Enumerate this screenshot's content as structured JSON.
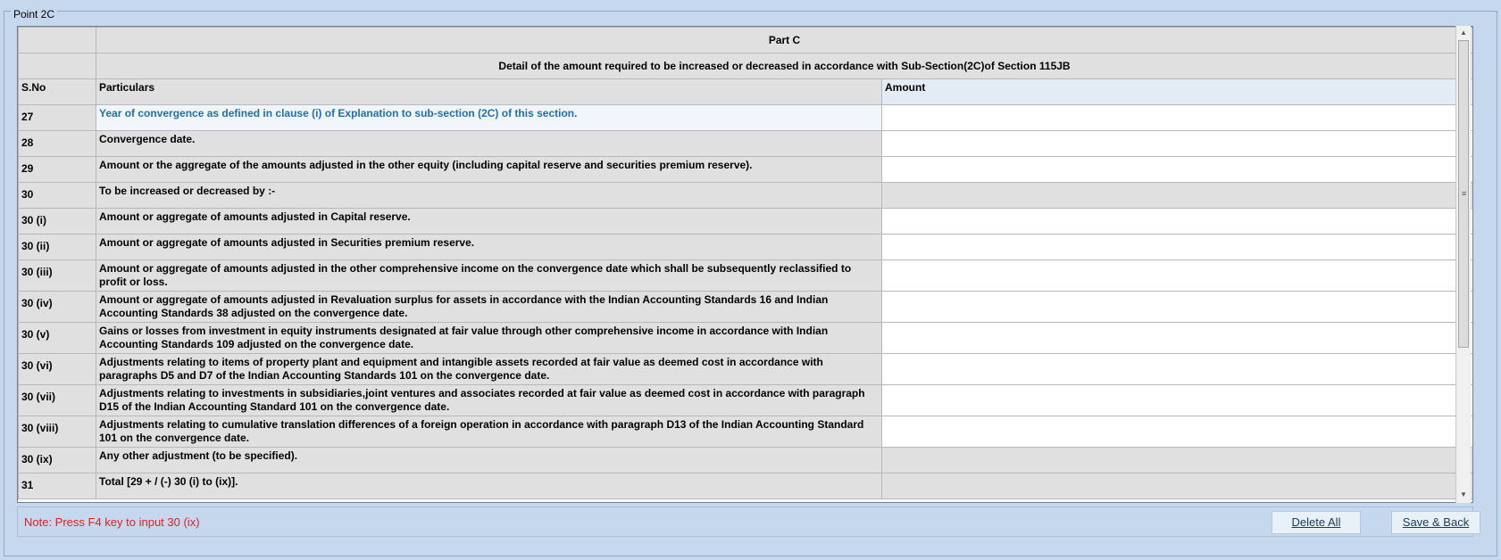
{
  "window": {
    "title": "Point 2C"
  },
  "table": {
    "header_part": "Part C",
    "header_detail": "Detail of the amount required to be increased or decreased in accordance with Sub-Section(2C)of Section 115JB",
    "columns": {
      "sno": "S.No",
      "particulars": "Particulars",
      "amount": "Amount"
    },
    "rows": [
      {
        "sno": "27",
        "particulars": "Year of convergence as defined in clause (i) of Explanation to sub-section (2C) of this section.",
        "amount": ""
      },
      {
        "sno": "28",
        "particulars": "Convergence date.",
        "amount": ""
      },
      {
        "sno": "29",
        "particulars": "Amount or the aggregate of the amounts adjusted in the other equity (including capital reserve and securities premium reserve).",
        "amount": ""
      },
      {
        "sno": "30",
        "particulars": "To be increased or decreased by :-",
        "amount": ""
      },
      {
        "sno": "30 (i)",
        "particulars": "Amount or  aggregate of amounts adjusted in  Capital reserve.",
        "amount": ""
      },
      {
        "sno": "30 (ii)",
        "particulars": "Amount or aggregate of amounts adjusted in Securities premium reserve.",
        "amount": ""
      },
      {
        "sno": "30 (iii)",
        "particulars": "Amount or aggregate of amounts adjusted in the other comprehensive income on the convergence date which shall be subsequently reclassified to profit or loss.",
        "amount": ""
      },
      {
        "sno": "30 (iv)",
        "particulars": "Amount or aggregate of amounts adjusted in Revaluation surplus for assets in accordance with the Indian Accounting Standards 16 and Indian Accounting Standards 38 adjusted on the convergence date.",
        "amount": ""
      },
      {
        "sno": "30 (v)",
        "particulars": "Gains or losses from investment in equity instruments designated at fair value through other comprehensive income in accordance with Indian Accounting Standards 109 adjusted on the convergence date.",
        "amount": ""
      },
      {
        "sno": "30 (vi)",
        "particulars": "Adjustments relating to items of property plant and equipment and intangible assets recorded at fair value as deemed cost in accordance with paragraphs D5 and D7 of the Indian Accounting Standards 101 on the convergence date.",
        "amount": ""
      },
      {
        "sno": "30 (vii)",
        "particulars": "Adjustments relating to investments in subsidiaries,joint ventures and associates recorded at fair value as deemed cost in accordance with paragraph D15 of the Indian Accounting Standard 101 on the convergence date.",
        "amount": ""
      },
      {
        "sno": "30 (viii)",
        "particulars": "Adjustments relating to cumulative translation differences of a foreign operation in accordance with paragraph D13 of the Indian Accounting Standard 101 on the convergence date.",
        "amount": ""
      },
      {
        "sno": "30 (ix)",
        "particulars": "Any other adjustment (to be specified).",
        "amount": ""
      },
      {
        "sno": "31",
        "particulars": "Total [29 + / (-) 30 (i) to (ix)].",
        "amount": ""
      }
    ]
  },
  "footer": {
    "note": "Note: Press F4 key to input 30 (ix)",
    "delete_all_label": "Delete All",
    "save_back_label": "Save & Back"
  },
  "colors": {
    "note": "#e02020",
    "selected_text": "#1f6fb4",
    "background": "#c5d8ee"
  }
}
